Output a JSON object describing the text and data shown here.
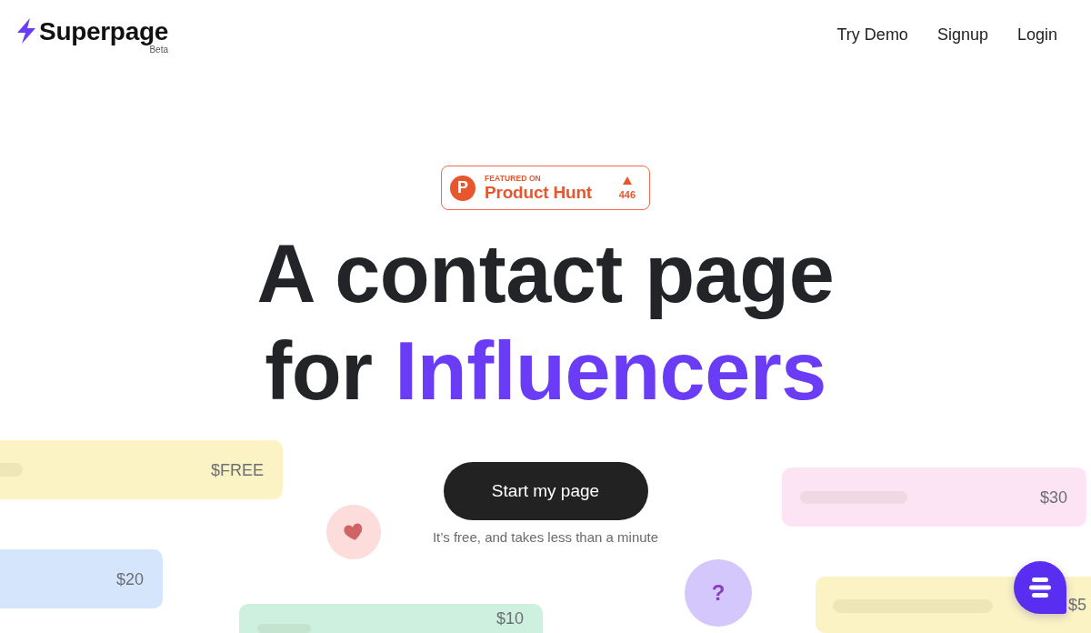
{
  "header": {
    "logo": {
      "name": "Superpage",
      "tag": "Beta"
    },
    "nav": [
      "Try Demo",
      "Signup",
      "Login"
    ]
  },
  "badge": {
    "logo_letter": "P",
    "eyebrow": "FEATURED ON",
    "name": "Product Hunt",
    "votes": "446"
  },
  "headline": {
    "line_1": "A contact page",
    "line_2": "for",
    "highlight": "Influencers"
  },
  "cta": {
    "label": "Start my page",
    "note": "It’s free, and takes less than a minute"
  },
  "cards": [
    {
      "price": "$FREE",
      "color": "#fbf3c3"
    },
    {
      "price": "$30",
      "color": "#fde4f5"
    },
    {
      "price": "$20",
      "color": "#d5e5fb"
    },
    {
      "price": "$5",
      "color": "#fbf3c3"
    },
    {
      "price": "$10",
      "color": "#cdf0df"
    }
  ],
  "bubbles": [
    {
      "kind": "heart"
    },
    {
      "kind": "question",
      "symbol": "?"
    }
  ]
}
